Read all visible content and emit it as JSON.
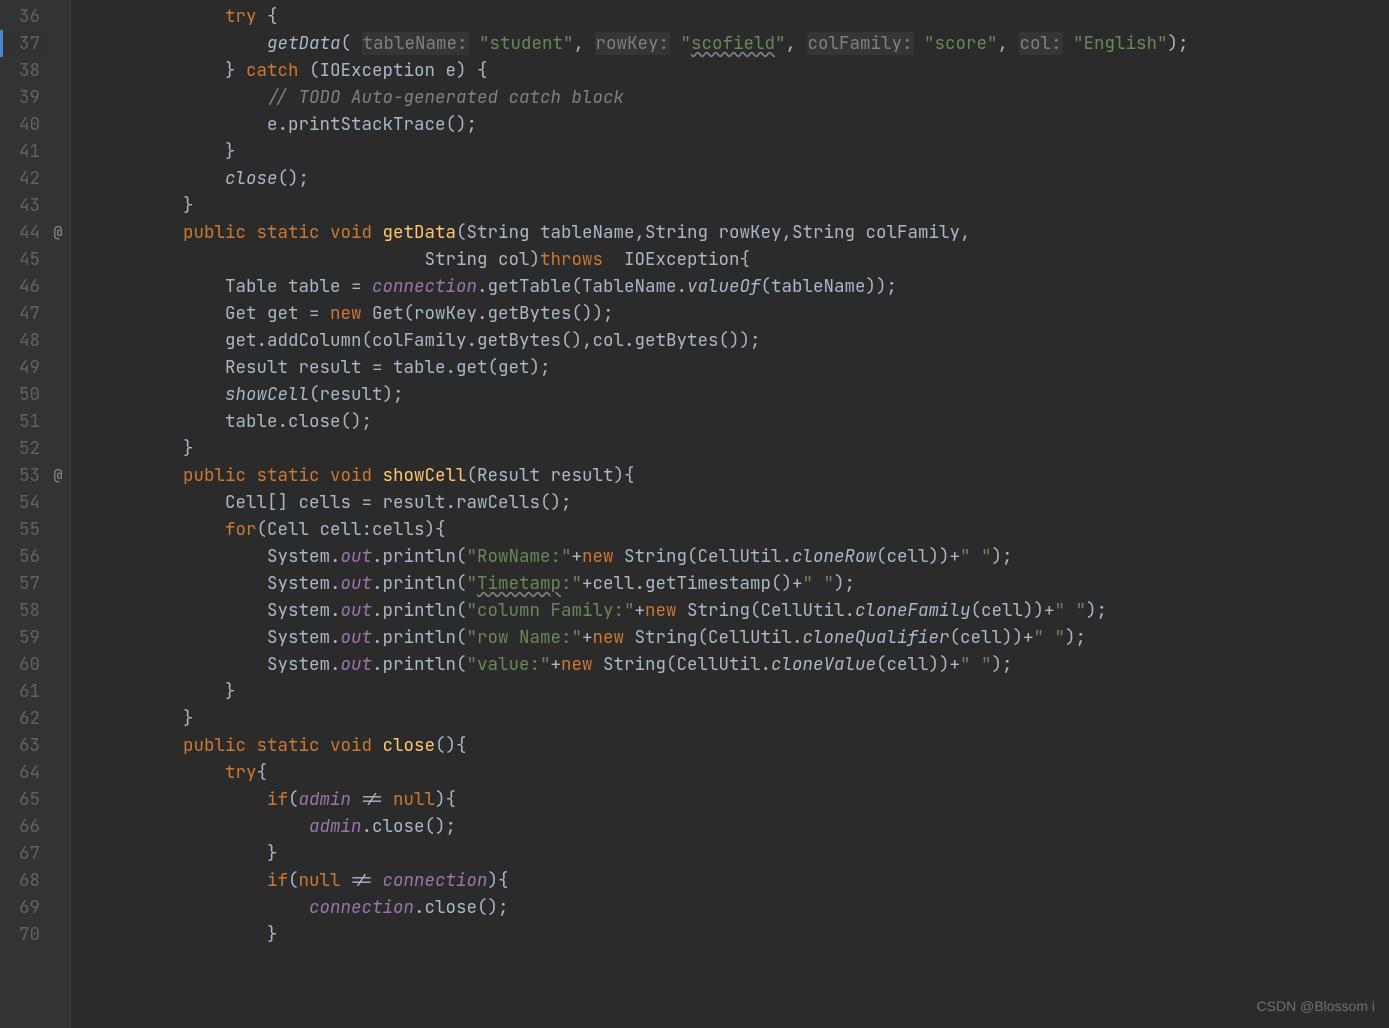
{
  "watermark": "CSDN @Blossom i",
  "lines": {
    "36": {
      "indent": "            ",
      "tokens": [
        {
          "cls": "kw",
          "txt": "try"
        },
        {
          "cls": "",
          "txt": " {"
        }
      ]
    },
    "37": {
      "indent": "                ",
      "tokens": [
        {
          "cls": "ital",
          "txt": "getData"
        },
        {
          "cls": "",
          "txt": "( "
        },
        {
          "cls": "param",
          "txt": "tableName:"
        },
        {
          "cls": "",
          "txt": " "
        },
        {
          "cls": "str",
          "txt": "\"student\""
        },
        {
          "cls": "",
          "txt": ", "
        },
        {
          "cls": "param",
          "txt": "rowKey:"
        },
        {
          "cls": "",
          "txt": " "
        },
        {
          "cls": "str",
          "txt": "\""
        },
        {
          "cls": "str warn",
          "txt": "scofield"
        },
        {
          "cls": "str",
          "txt": "\""
        },
        {
          "cls": "",
          "txt": ", "
        },
        {
          "cls": "param",
          "txt": "colFamily:"
        },
        {
          "cls": "",
          "txt": " "
        },
        {
          "cls": "str",
          "txt": "\"score\""
        },
        {
          "cls": "",
          "txt": ", "
        },
        {
          "cls": "param",
          "txt": "col:"
        },
        {
          "cls": "",
          "txt": " "
        },
        {
          "cls": "str",
          "txt": "\"English\""
        },
        {
          "cls": "",
          "txt": ");"
        }
      ]
    },
    "38": {
      "indent": "            ",
      "tokens": [
        {
          "cls": "",
          "txt": "} "
        },
        {
          "cls": "kw",
          "txt": "catch"
        },
        {
          "cls": "",
          "txt": " (IOException e) {"
        }
      ]
    },
    "39": {
      "indent": "                ",
      "tokens": [
        {
          "cls": "com",
          "txt": "// TODO Auto-generated catch block"
        }
      ]
    },
    "40": {
      "indent": "                ",
      "tokens": [
        {
          "cls": "",
          "txt": "e.printStackTrace();"
        }
      ]
    },
    "41": {
      "indent": "            ",
      "tokens": [
        {
          "cls": "",
          "txt": "}"
        }
      ]
    },
    "42": {
      "indent": "            ",
      "tokens": [
        {
          "cls": "ital",
          "txt": "close"
        },
        {
          "cls": "",
          "txt": "();"
        }
      ]
    },
    "43": {
      "indent": "        ",
      "tokens": [
        {
          "cls": "",
          "txt": "}"
        }
      ]
    },
    "44": {
      "indent": "        ",
      "tokens": [
        {
          "cls": "kw",
          "txt": "public static void "
        },
        {
          "cls": "mname",
          "txt": "getData"
        },
        {
          "cls": "",
          "txt": "(String tableName,String rowKey,String colFamily,"
        }
      ]
    },
    "45": {
      "indent": "                               ",
      "tokens": [
        {
          "cls": "",
          "txt": "String col)"
        },
        {
          "cls": "kw",
          "txt": "throws"
        },
        {
          "cls": "",
          "txt": "  IOException{"
        }
      ]
    },
    "46": {
      "indent": "            ",
      "tokens": [
        {
          "cls": "",
          "txt": "Table table = "
        },
        {
          "cls": "field",
          "txt": "connection"
        },
        {
          "cls": "",
          "txt": ".getTable(TableName."
        },
        {
          "cls": "ital",
          "txt": "valueOf"
        },
        {
          "cls": "",
          "txt": "(tableName));"
        }
      ]
    },
    "47": {
      "indent": "            ",
      "tokens": [
        {
          "cls": "",
          "txt": "Get get = "
        },
        {
          "cls": "kw",
          "txt": "new"
        },
        {
          "cls": "",
          "txt": " Get(rowKey.getBytes());"
        }
      ]
    },
    "48": {
      "indent": "            ",
      "tokens": [
        {
          "cls": "",
          "txt": "get.addColumn(colFamily.getBytes(),col.getBytes());"
        }
      ]
    },
    "49": {
      "indent": "            ",
      "tokens": [
        {
          "cls": "",
          "txt": "Result result = table.get(get);"
        }
      ]
    },
    "50": {
      "indent": "            ",
      "tokens": [
        {
          "cls": "ital",
          "txt": "showCell"
        },
        {
          "cls": "",
          "txt": "(result);"
        }
      ]
    },
    "51": {
      "indent": "            ",
      "tokens": [
        {
          "cls": "",
          "txt": "table.close();"
        }
      ]
    },
    "52": {
      "indent": "        ",
      "tokens": [
        {
          "cls": "",
          "txt": "}"
        }
      ]
    },
    "53": {
      "indent": "        ",
      "tokens": [
        {
          "cls": "kw",
          "txt": "public static void "
        },
        {
          "cls": "mname",
          "txt": "showCell"
        },
        {
          "cls": "",
          "txt": "(Result result){"
        }
      ]
    },
    "54": {
      "indent": "            ",
      "tokens": [
        {
          "cls": "",
          "txt": "Cell[] cells = result.rawCells();"
        }
      ]
    },
    "55": {
      "indent": "            ",
      "tokens": [
        {
          "cls": "kw",
          "txt": "for"
        },
        {
          "cls": "",
          "txt": "(Cell cell:cells){"
        }
      ]
    },
    "56": {
      "indent": "                ",
      "tokens": [
        {
          "cls": "",
          "txt": "System."
        },
        {
          "cls": "field",
          "txt": "out"
        },
        {
          "cls": "",
          "txt": ".println("
        },
        {
          "cls": "str",
          "txt": "\"RowName:\""
        },
        {
          "cls": "",
          "txt": "+"
        },
        {
          "cls": "kw",
          "txt": "new"
        },
        {
          "cls": "",
          "txt": " String(CellUtil."
        },
        {
          "cls": "ital",
          "txt": "cloneRow"
        },
        {
          "cls": "",
          "txt": "(cell))+"
        },
        {
          "cls": "str",
          "txt": "\" \""
        },
        {
          "cls": "",
          "txt": ");"
        }
      ]
    },
    "57": {
      "indent": "                ",
      "tokens": [
        {
          "cls": "",
          "txt": "System."
        },
        {
          "cls": "field",
          "txt": "out"
        },
        {
          "cls": "",
          "txt": ".println("
        },
        {
          "cls": "str",
          "txt": "\""
        },
        {
          "cls": "str warn",
          "txt": "Timetamp"
        },
        {
          "cls": "str",
          "txt": ":\""
        },
        {
          "cls": "",
          "txt": "+cell.getTimestamp()+"
        },
        {
          "cls": "str",
          "txt": "\" \""
        },
        {
          "cls": "",
          "txt": ");"
        }
      ]
    },
    "58": {
      "indent": "                ",
      "tokens": [
        {
          "cls": "",
          "txt": "System."
        },
        {
          "cls": "field",
          "txt": "out"
        },
        {
          "cls": "",
          "txt": ".println("
        },
        {
          "cls": "str",
          "txt": "\"column Family:\""
        },
        {
          "cls": "",
          "txt": "+"
        },
        {
          "cls": "kw",
          "txt": "new"
        },
        {
          "cls": "",
          "txt": " String(CellUtil."
        },
        {
          "cls": "ital",
          "txt": "cloneFamily"
        },
        {
          "cls": "",
          "txt": "(cell))+"
        },
        {
          "cls": "str",
          "txt": "\" \""
        },
        {
          "cls": "",
          "txt": ");"
        }
      ]
    },
    "59": {
      "indent": "                ",
      "tokens": [
        {
          "cls": "",
          "txt": "System."
        },
        {
          "cls": "field",
          "txt": "out"
        },
        {
          "cls": "",
          "txt": ".println("
        },
        {
          "cls": "str",
          "txt": "\"row Name:\""
        },
        {
          "cls": "",
          "txt": "+"
        },
        {
          "cls": "kw",
          "txt": "new"
        },
        {
          "cls": "",
          "txt": " String(CellUtil."
        },
        {
          "cls": "ital",
          "txt": "cloneQualifier"
        },
        {
          "cls": "",
          "txt": "(cell))+"
        },
        {
          "cls": "str",
          "txt": "\" \""
        },
        {
          "cls": "",
          "txt": ");"
        }
      ]
    },
    "60": {
      "indent": "                ",
      "tokens": [
        {
          "cls": "",
          "txt": "System."
        },
        {
          "cls": "field",
          "txt": "out"
        },
        {
          "cls": "",
          "txt": ".println("
        },
        {
          "cls": "str",
          "txt": "\"value:\""
        },
        {
          "cls": "",
          "txt": "+"
        },
        {
          "cls": "kw",
          "txt": "new"
        },
        {
          "cls": "",
          "txt": " String(CellUtil."
        },
        {
          "cls": "ital",
          "txt": "cloneValue"
        },
        {
          "cls": "",
          "txt": "(cell))+"
        },
        {
          "cls": "str",
          "txt": "\" \""
        },
        {
          "cls": "",
          "txt": ");"
        }
      ]
    },
    "61": {
      "indent": "            ",
      "tokens": [
        {
          "cls": "",
          "txt": "}"
        }
      ]
    },
    "62": {
      "indent": "        ",
      "tokens": [
        {
          "cls": "",
          "txt": "}"
        }
      ]
    },
    "63": {
      "indent": "        ",
      "tokens": [
        {
          "cls": "kw",
          "txt": "public static void "
        },
        {
          "cls": "mname",
          "txt": "close"
        },
        {
          "cls": "",
          "txt": "(){"
        }
      ]
    },
    "64": {
      "indent": "            ",
      "tokens": [
        {
          "cls": "kw",
          "txt": "try"
        },
        {
          "cls": "",
          "txt": "{"
        }
      ]
    },
    "65": {
      "indent": "                ",
      "tokens": [
        {
          "cls": "kw",
          "txt": "if"
        },
        {
          "cls": "",
          "txt": "("
        },
        {
          "cls": "field",
          "txt": "admin"
        },
        {
          "cls": "",
          "txt": " != "
        },
        {
          "cls": "kw",
          "txt": "null"
        },
        {
          "cls": "",
          "txt": "){"
        }
      ]
    },
    "66": {
      "indent": "                    ",
      "tokens": [
        {
          "cls": "field",
          "txt": "admin"
        },
        {
          "cls": "",
          "txt": ".close();"
        }
      ]
    },
    "67": {
      "indent": "                ",
      "tokens": [
        {
          "cls": "",
          "txt": "}"
        }
      ]
    },
    "68": {
      "indent": "                ",
      "tokens": [
        {
          "cls": "kw",
          "txt": "if"
        },
        {
          "cls": "",
          "txt": "("
        },
        {
          "cls": "kw",
          "txt": "null"
        },
        {
          "cls": "",
          "txt": " != "
        },
        {
          "cls": "field",
          "txt": "connection"
        },
        {
          "cls": "",
          "txt": "){"
        }
      ]
    },
    "69": {
      "indent": "                    ",
      "tokens": [
        {
          "cls": "field",
          "txt": "connection"
        },
        {
          "cls": "",
          "txt": ".close();"
        }
      ]
    },
    "70": {
      "indent": "                ",
      "tokens": [
        {
          "cls": "",
          "txt": "}"
        }
      ]
    }
  },
  "gutter_marks": {
    "44": "@",
    "53": "@"
  },
  "first_line": 36,
  "last_line": 70
}
